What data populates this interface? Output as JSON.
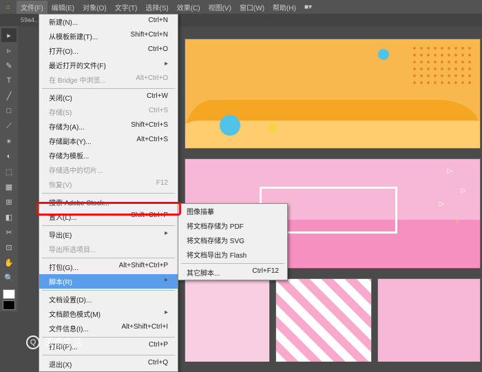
{
  "menubar": {
    "items": [
      "文件(F)",
      "编辑(E)",
      "对象(O)",
      "文字(T)",
      "选择(S)",
      "效果(C)",
      "视图(V)",
      "窗口(W)",
      "帮助(H)"
    ],
    "extra": "■▾"
  },
  "tab": {
    "name": "59a4..."
  },
  "file_menu": [
    {
      "l": "新建(N)...",
      "s": "Ctrl+N"
    },
    {
      "l": "从模板新建(T)...",
      "s": "Shift+Ctrl+N"
    },
    {
      "l": "打开(O)...",
      "s": "Ctrl+O"
    },
    {
      "l": "最近打开的文件(F)",
      "s": "",
      "sub": true
    },
    {
      "l": "在 Bridge 中浏览...",
      "s": "Alt+Ctrl+O",
      "dis": true
    },
    {
      "sep": true
    },
    {
      "l": "关闭(C)",
      "s": "Ctrl+W"
    },
    {
      "l": "存储(S)",
      "s": "Ctrl+S",
      "dis": true
    },
    {
      "l": "存储为(A)...",
      "s": "Shift+Ctrl+S"
    },
    {
      "l": "存储副本(Y)...",
      "s": "Alt+Ctrl+S"
    },
    {
      "l": "存储为模板...",
      "s": ""
    },
    {
      "l": "存储选中的切片...",
      "s": "",
      "dis": true
    },
    {
      "l": "恢复(V)",
      "s": "F12",
      "dis": true
    },
    {
      "sep": true
    },
    {
      "l": "搜索 Adobe Stock...",
      "s": ""
    },
    {
      "l": "置入(L)...",
      "s": "Shift+Ctrl+P"
    },
    {
      "sep": true
    },
    {
      "l": "导出(E)",
      "s": "",
      "sub": true
    },
    {
      "l": "导出所选项目...",
      "s": "",
      "dis": true
    },
    {
      "sep": true
    },
    {
      "l": "打包(G)...",
      "s": "Alt+Shift+Ctrl+P"
    },
    {
      "l": "脚本(R)",
      "s": "",
      "sub": true,
      "hl": true
    },
    {
      "sep": true
    },
    {
      "l": "文档设置(D)...",
      "s": ""
    },
    {
      "l": "文档颜色模式(M)",
      "s": "",
      "sub": true
    },
    {
      "l": "文件信息(I)...",
      "s": "Alt+Shift+Ctrl+I"
    },
    {
      "sep": true
    },
    {
      "l": "打印(P)...",
      "s": "Ctrl+P"
    },
    {
      "sep": true
    },
    {
      "l": "退出(X)",
      "s": "Ctrl+Q"
    }
  ],
  "script_submenu": [
    {
      "l": "图像描摹",
      "s": ""
    },
    {
      "l": "将文档存储为 PDF",
      "s": ""
    },
    {
      "l": "将文档存储为 SVG",
      "s": ""
    },
    {
      "l": "将文档导出为 Flash",
      "s": ""
    },
    {
      "sep": true
    },
    {
      "l": "其它脚本...",
      "s": "Ctrl+F12"
    }
  ],
  "tools": [
    "▸",
    "▹",
    "✎",
    "T",
    "╱",
    "□",
    "⟋",
    "✴",
    "◐",
    "⬚",
    "▦",
    "⊞",
    "◧",
    "✂",
    "⊡",
    "✋",
    "🔍"
  ],
  "watermark": "天奇生活"
}
